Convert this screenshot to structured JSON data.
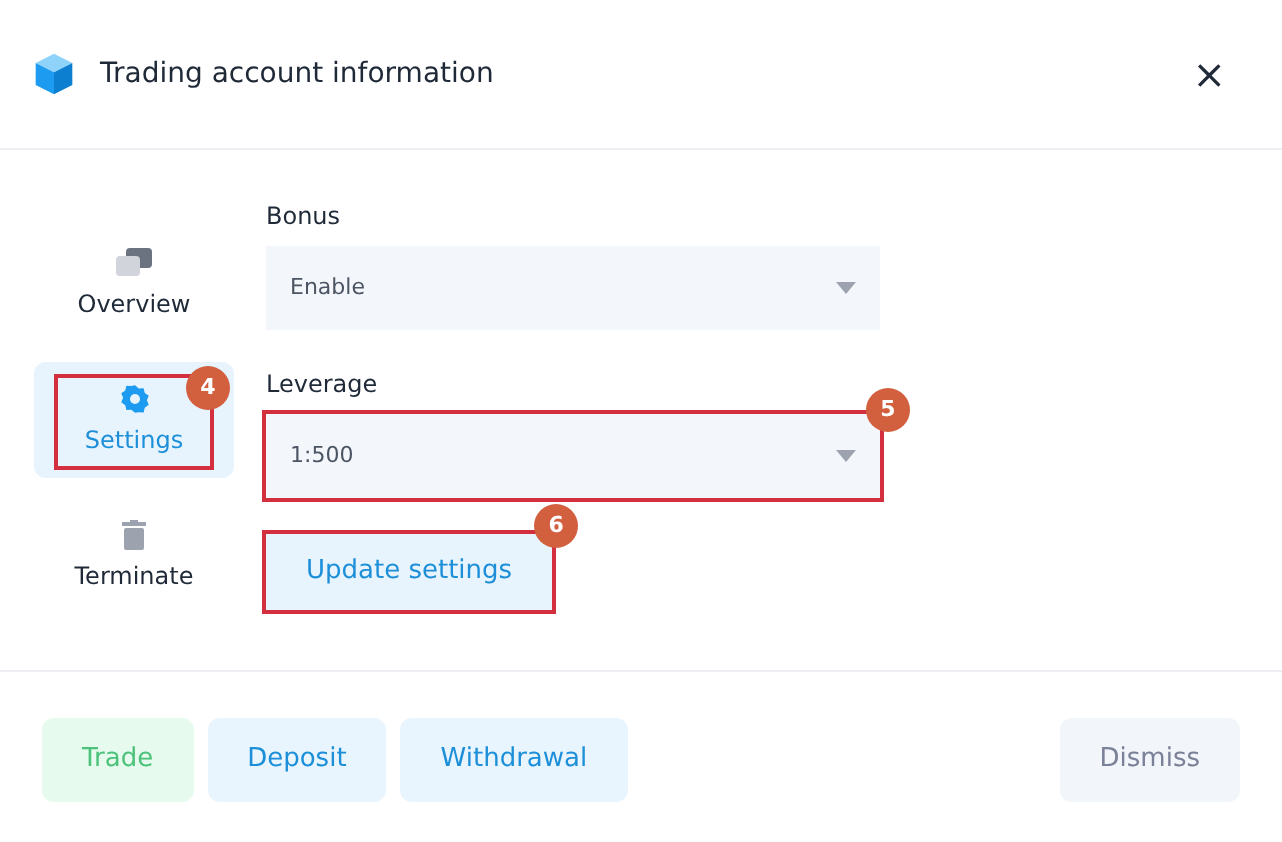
{
  "window": {
    "title": "Trading account information",
    "close": "×"
  },
  "sidebar": {
    "items": [
      {
        "kind": "overview",
        "label": "Overview",
        "selected": false
      },
      {
        "kind": "settings",
        "label": "Settings",
        "selected": true,
        "annotation": "4"
      },
      {
        "kind": "terminate",
        "label": "Terminate",
        "selected": false
      }
    ]
  },
  "form": {
    "fields": [
      {
        "label": "Bonus",
        "value": "Enable"
      },
      {
        "label": "Leverage",
        "value": "1:500",
        "annotation": "5"
      }
    ],
    "submit": {
      "label": "Update settings",
      "annotation": "6"
    }
  },
  "footer": {
    "buttons": [
      {
        "label": "Trade",
        "kind": "green"
      },
      {
        "label": "Deposit",
        "kind": "blue"
      },
      {
        "label": "Withdrawal",
        "kind": "blue"
      },
      {
        "label": "Dismiss",
        "kind": "grey"
      }
    ]
  }
}
